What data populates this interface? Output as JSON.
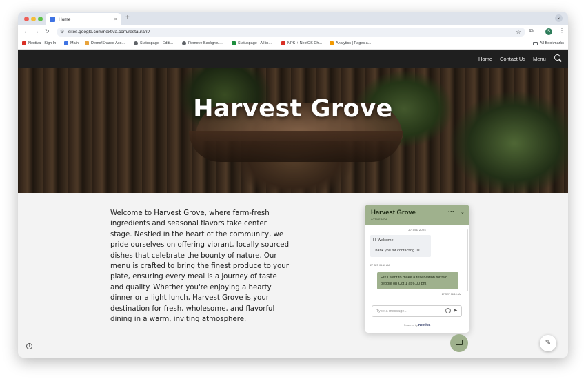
{
  "browser": {
    "tab_title": "Home",
    "tab_close": "×",
    "new_tab": "+",
    "url": "sites.google.com/nextiva.com/restaurant/",
    "profile_initial": "S",
    "bookmarks": [
      {
        "label": "Nextiva - Sign In",
        "color": "#d93025"
      },
      {
        "label": "Main",
        "color": "#3f73e3"
      },
      {
        "label": "Demo/Shared Acc...",
        "color": "#e8a33b"
      },
      {
        "label": "Statuspage - Editi...",
        "color": "#5f6368"
      },
      {
        "label": "Remove Backgrou...",
        "color": "#5f6368"
      },
      {
        "label": "Statuspage - All in...",
        "color": "#1e8e3e"
      },
      {
        "label": "NPS + NextOS Ch...",
        "color": "#d93025"
      },
      {
        "label": "Analytics | Pages a...",
        "color": "#f29900"
      }
    ],
    "all_bookmarks": "All Bookmarks"
  },
  "site": {
    "nav": {
      "home": "Home",
      "contact": "Contact Us",
      "menu": "Menu"
    },
    "hero_title": "Harvest Grove",
    "intro": "Welcome to Harvest Grove, where farm-fresh ingredients and seasonal flavors take center stage. Nestled in the heart of the community, we pride ourselves on offering vibrant, locally sourced dishes that celebrate the bounty of nature. Our menu is crafted to bring the finest produce to your plate, ensuring every meal is a journey of taste and quality. Whether you're enjoying a hearty dinner or a light lunch, Harvest Grove is your destination for fresh, wholesome, and flavorful dining in a warm, inviting atmosphere."
  },
  "chat": {
    "title": "Harvest Grove",
    "status": "ACTIVE NOW",
    "date": "27 Sep 2024",
    "incoming": [
      "Hi Welcome",
      "Thank you for contacting us."
    ],
    "incoming_time": "27 SEP 06:10 AM",
    "outgoing": "Hi!! I want to make a reservation for two people on Oct 1 at 6.00 pm.",
    "outgoing_time": "27 SEP 06:10 AM",
    "placeholder": "Type a message...",
    "powered_by": "Powered by",
    "brand": "nextiva"
  },
  "colors": {
    "accent": "#9fb18d",
    "nav_bg": "#1f1f1f"
  }
}
